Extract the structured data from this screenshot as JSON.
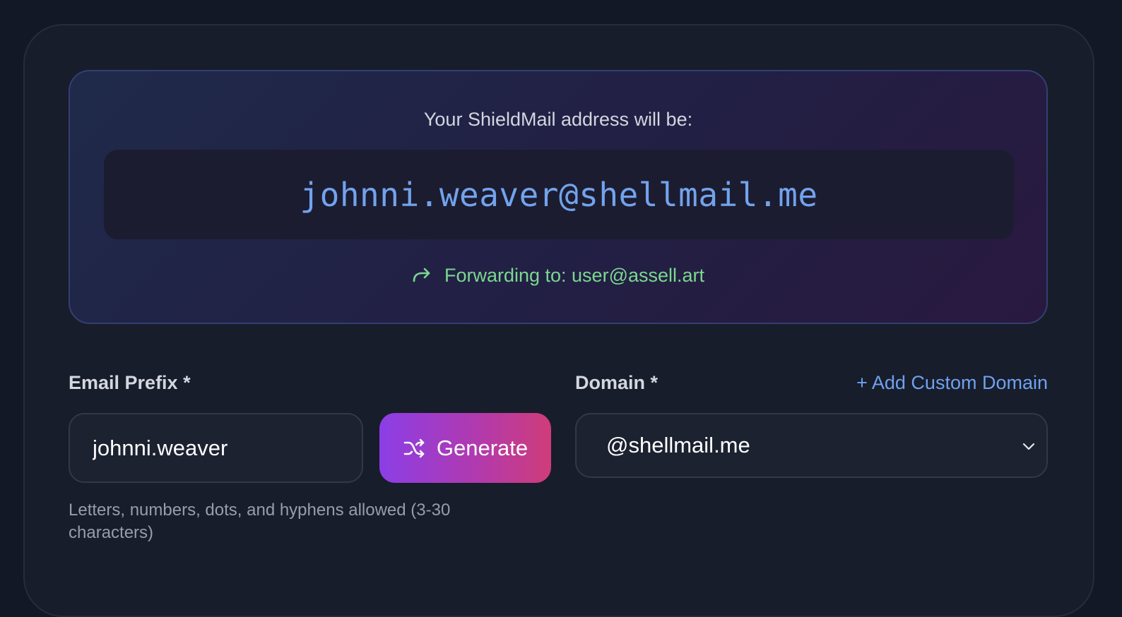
{
  "preview": {
    "label": "Your ShieldMail address will be:",
    "address": "johnni.weaver@shellmail.me",
    "forwarding_text": "Forwarding to: user@assell.art",
    "forward_icon": "arrow-forward-icon"
  },
  "prefix": {
    "label": "Email Prefix *",
    "value": "johnni.weaver",
    "helper": "Letters, numbers, dots, and hyphens allowed (3-30 characters)"
  },
  "generate": {
    "label": "Generate",
    "icon": "shuffle-icon"
  },
  "domain": {
    "label": "Domain *",
    "add_link": "+ Add Custom Domain",
    "selected": "@shellmail.me",
    "icon": "chevron-down-icon"
  },
  "colors": {
    "accent_blue": "#72a3ee",
    "forward_green": "#7bd88f",
    "gradient_start": "#8b3ee6",
    "gradient_end": "#cf3c79",
    "background": "#121826"
  }
}
